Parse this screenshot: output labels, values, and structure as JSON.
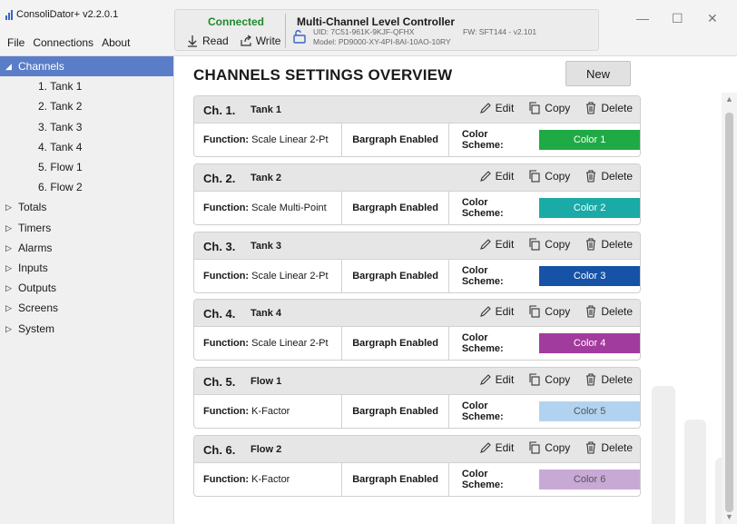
{
  "app": {
    "title": "ConsoliDator+ v2.2.0.1",
    "menu": [
      "File",
      "Connections",
      "About"
    ]
  },
  "connection": {
    "status": "Connected",
    "read_label": "Read",
    "write_label": "Write",
    "device_name": "Multi-Channel Level Controller",
    "uid": "UID: 7C51-961K-9KJF-QFHX",
    "model": "Model: PD9000-XY-4PI-8AI-10AO-10RY",
    "fw": "FW: SFT144 - v2.101",
    "status_color": "#1e8a2e"
  },
  "window_controls": {
    "minimize": "—",
    "maximize": "☐",
    "close": "✕"
  },
  "sidebar": {
    "channels_label": "Channels",
    "channel_items": [
      "1. Tank 1",
      "2. Tank 2",
      "3. Tank  3",
      "4. Tank 4",
      "5. Flow 1",
      "6. Flow 2"
    ],
    "sections": [
      "Totals",
      "Timers",
      "Alarms",
      "Inputs",
      "Outputs",
      "Screens",
      "System"
    ],
    "selected_color": "#5a7dc7"
  },
  "main": {
    "title": "CHANNELS SETTINGS OVERVIEW",
    "new_button": "New",
    "function_label": "Function:",
    "color_scheme_label": "Color Scheme:",
    "edit_label": "Edit",
    "copy_label": "Copy",
    "delete_label": "Delete",
    "channels": [
      {
        "label": "Ch. 1.",
        "name": "Tank 1",
        "function": "Scale Linear 2-Pt",
        "bargraph": "Bargraph Enabled",
        "color_name": "Color 1",
        "color": "#1faa45",
        "text_color": "#ffffff"
      },
      {
        "label": "Ch. 2.",
        "name": "Tank 2",
        "function": "Scale Multi-Point",
        "bargraph": "Bargraph Enabled",
        "color_name": "Color 2",
        "color": "#1aaba6",
        "text_color": "#ffffff"
      },
      {
        "label": "Ch. 3.",
        "name": "Tank  3",
        "function": "Scale Linear 2-Pt",
        "bargraph": "Bargraph Enabled",
        "color_name": "Color 3",
        "color": "#1652a6",
        "text_color": "#ffffff"
      },
      {
        "label": "Ch. 4.",
        "name": "Tank 4",
        "function": "Scale Linear 2-Pt",
        "bargraph": "Bargraph Enabled",
        "color_name": "Color 4",
        "color": "#a23b9e",
        "text_color": "#ffffff"
      },
      {
        "label": "Ch. 5.",
        "name": "Flow 1",
        "function": "K-Factor",
        "bargraph": "Bargraph Enabled",
        "color_name": "Color 5",
        "color": "#b1d3ef",
        "text_color": "#555555"
      },
      {
        "label": "Ch. 6.",
        "name": "Flow 2",
        "function": "K-Factor",
        "bargraph": "Bargraph Enabled",
        "color_name": "Color 6",
        "color": "#c8a9d6",
        "text_color": "#555555"
      }
    ]
  }
}
